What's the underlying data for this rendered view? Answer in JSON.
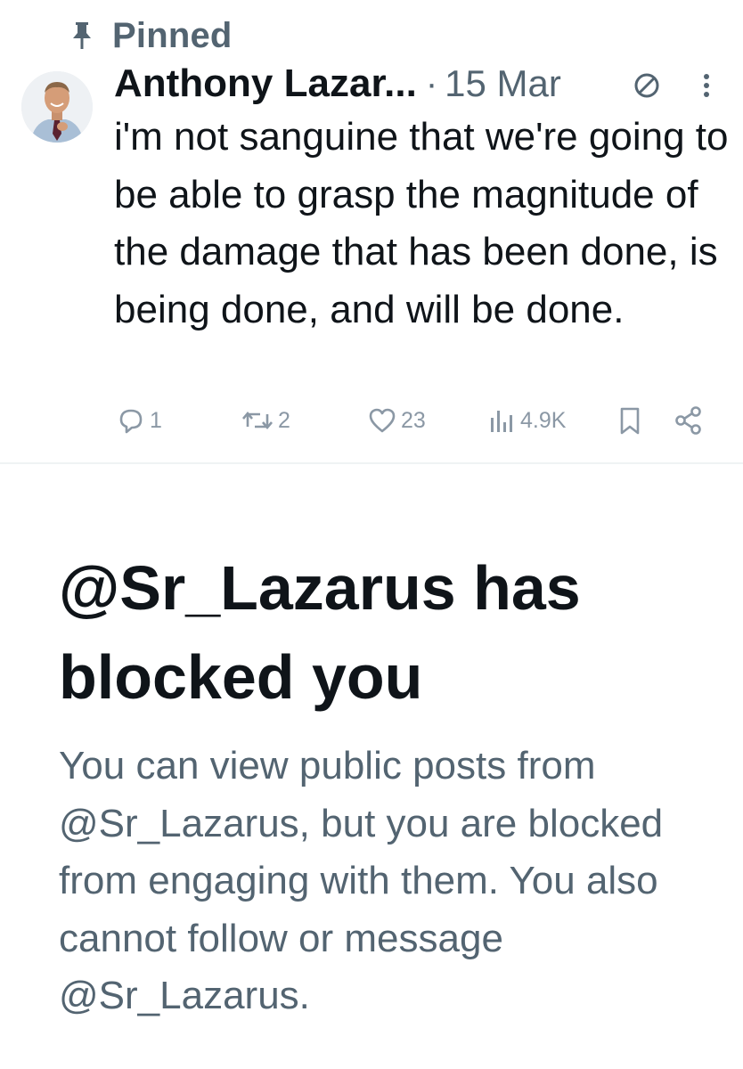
{
  "pinned": {
    "label": "Pinned",
    "icon": "pin-icon"
  },
  "tweet": {
    "avatar_icon": "avatar",
    "author_name": "Anthony Lazar...",
    "separator": "·",
    "date": "15 Mar",
    "restricted_icon": "reply-restricted-icon",
    "more_icon": "more-vertical-icon",
    "text": "i'm not sanguine that we're going to be able to grasp the magnitude of the damage that has been done, is being done, and will be done.",
    "actions": {
      "replies": {
        "icon": "reply-icon",
        "count": "1"
      },
      "reposts": {
        "icon": "repost-icon",
        "count": "2"
      },
      "likes": {
        "icon": "like-icon",
        "count": "23"
      },
      "views": {
        "icon": "views-icon",
        "count": "4.9K"
      },
      "bookmark": {
        "icon": "bookmark-icon"
      },
      "share": {
        "icon": "share-icon"
      }
    }
  },
  "blocked": {
    "title": "@Sr_Lazarus has blocked you",
    "description": "You can view public posts from @Sr_Lazarus, but you are blocked from engaging with them. You also cannot follow or message @Sr_Lazarus."
  },
  "colors": {
    "text_primary": "#0f1419",
    "text_secondary": "#536471",
    "icon_muted": "#8b98a5",
    "divider": "#eff3f4",
    "background": "#ffffff"
  }
}
